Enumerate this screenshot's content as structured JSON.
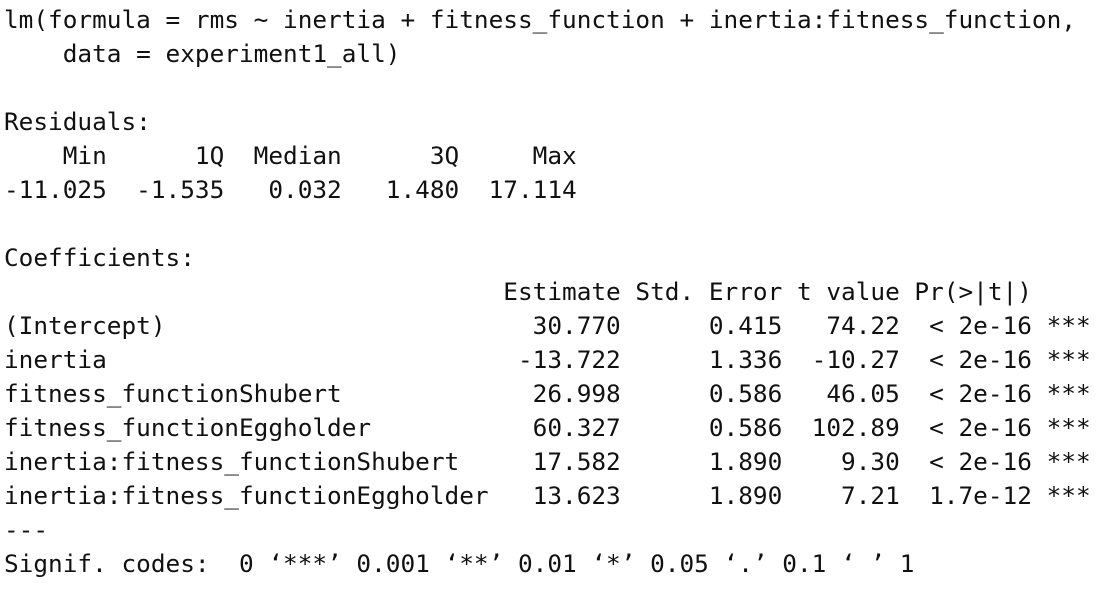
{
  "call": {
    "line1": "lm(formula = rms ~ inertia + fitness_function + inertia:fitness_function,",
    "line2": "    data = experiment1_all)"
  },
  "residuals": {
    "title": "Residuals:",
    "header": "    Min      1Q  Median      3Q     Max",
    "values": "-11.025  -1.535   0.032   1.480  17.114"
  },
  "coefficients": {
    "title": "Coefficients:",
    "header": "                                  Estimate Std. Error t value Pr(>|t|)    ",
    "rows": [
      "(Intercept)                         30.770      0.415   74.22  < 2e-16 ***",
      "inertia                            -13.722      1.336  -10.27  < 2e-16 ***",
      "fitness_functionShubert             26.998      0.586   46.05  < 2e-16 ***",
      "fitness_functionEggholder           60.327      0.586  102.89  < 2e-16 ***",
      "inertia:fitness_functionShubert     17.582      1.890    9.30  < 2e-16 ***",
      "inertia:fitness_functionEggholder   13.623      1.890    7.21  1.7e-12 ***"
    ]
  },
  "separator": "---",
  "signif_codes": "Signif. codes:  0 ‘***’ 0.001 ‘**’ 0.01 ‘*’ 0.05 ‘.’ 0.1 ‘ ’ 1"
}
